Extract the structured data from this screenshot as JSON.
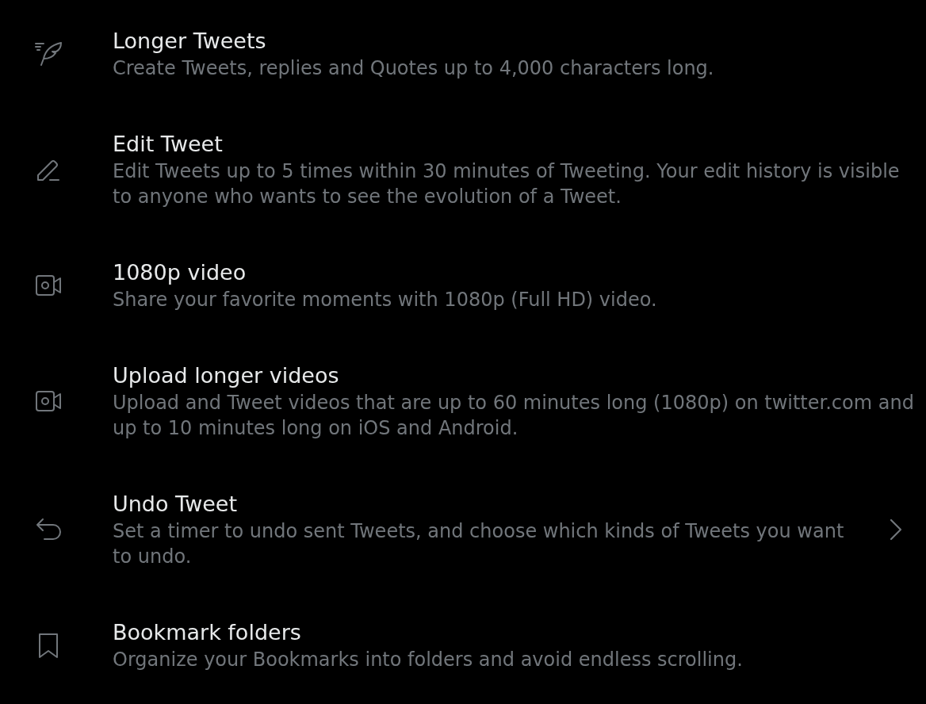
{
  "features": [
    {
      "kind": "feather",
      "title": "Longer Tweets",
      "description": "Create Tweets, replies and Quotes up to 4,000 characters long.",
      "navigable": false
    },
    {
      "kind": "pencil",
      "title": "Edit Tweet",
      "description": "Edit Tweets up to 5 times within 30 minutes of Tweeting. Your edit history is visible to anyone who wants to see the evolution of a Tweet.",
      "navigable": false
    },
    {
      "kind": "video",
      "title": "1080p video",
      "description": "Share your favorite moments with 1080p (Full HD) video.",
      "navigable": false
    },
    {
      "kind": "video",
      "title": "Upload longer videos",
      "description": "Upload and Tweet videos that are up to 60 minutes long (1080p) on twitter.com and up to 10 minutes long on iOS and Android.",
      "navigable": false
    },
    {
      "kind": "undo",
      "title": "Undo Tweet",
      "description": "Set a timer to undo sent Tweets, and choose which kinds of Tweets you want to undo.",
      "navigable": true
    },
    {
      "kind": "bookmark",
      "title": "Bookmark folders",
      "description": "Organize your Bookmarks into folders and avoid endless scrolling.",
      "navigable": false
    }
  ]
}
